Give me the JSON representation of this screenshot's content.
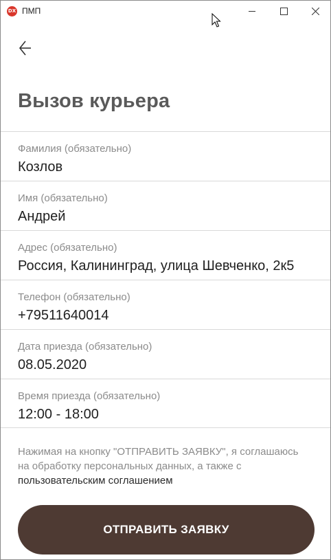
{
  "window": {
    "app_icon_text": "DX",
    "title": "ПМП"
  },
  "page": {
    "title": "Вызов курьера"
  },
  "fields": [
    {
      "label": "Фамилия (обязательно)",
      "value": "Козлов"
    },
    {
      "label": "Имя (обязательно)",
      "value": "Андрей"
    },
    {
      "label": "Адрес (обязательно)",
      "value": "Россия, Калининград, улица Шевченко, 2к5"
    },
    {
      "label": "Телефон (обязательно)",
      "value": "+79511640014"
    },
    {
      "label": "Дата приезда (обязательно)",
      "value": "08.05.2020"
    },
    {
      "label": "Время приезда (обязательно)",
      "value": "12:00 - 18:00"
    }
  ],
  "consent": {
    "text": "Нажимая на кнопку \"ОТПРАВИТЬ ЗАЯВКУ\", я соглашаюсь на обработку персональных данных, а также с ",
    "link": "пользовательским соглашением"
  },
  "submit": {
    "label": "ОТПРАВИТЬ ЗАЯВКУ"
  },
  "colors": {
    "accent": "#4e3a33",
    "app_icon": "#d9362b"
  },
  "icons": {
    "back": "arrow-left-icon",
    "minimize": "minimize-icon",
    "maximize": "maximize-icon",
    "close": "close-icon",
    "cursor": "mouse-pointer-icon"
  }
}
